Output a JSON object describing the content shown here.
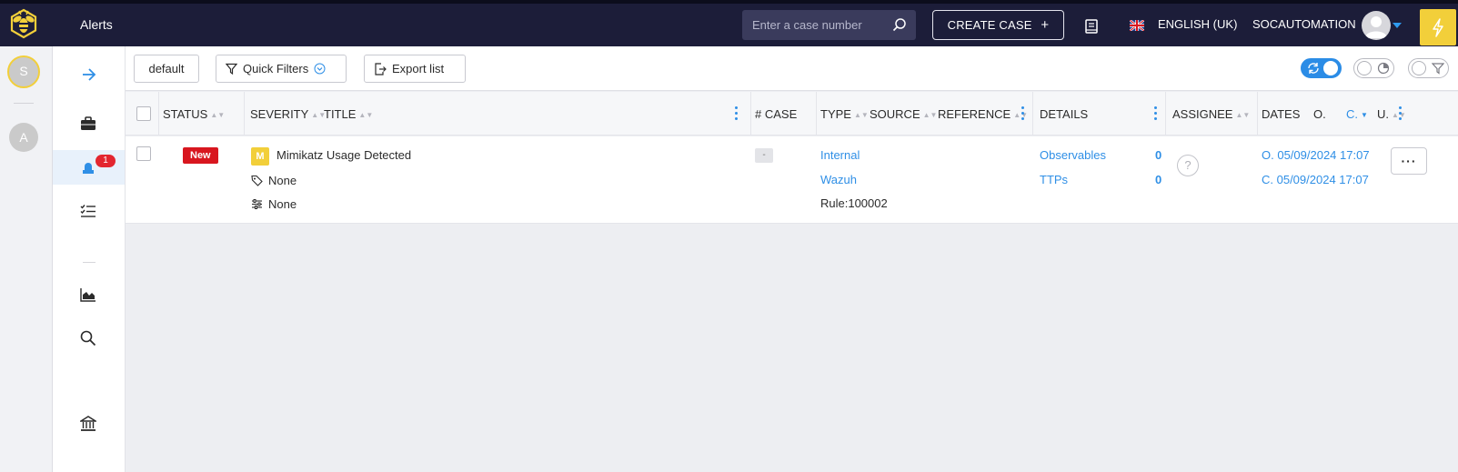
{
  "topbar": {
    "page_title": "Alerts",
    "search_placeholder": "Enter a case number",
    "create_case_label": "CREATE CASE",
    "language": "ENGLISH (UK)",
    "org": "SOCAUTOMATION"
  },
  "rail": {
    "org_initial": "S",
    "user_initial": "A"
  },
  "sidenav": {
    "alerts_badge": "1"
  },
  "toolbar": {
    "filter_default": "default",
    "quick_filters": "Quick Filters",
    "export_list": "Export list"
  },
  "table": {
    "headers": {
      "status": "STATUS",
      "severity": "SEVERITY",
      "title": "TITLE",
      "case": "# CASE",
      "type": "TYPE",
      "source": "SOURCE",
      "reference": "REFERENCE",
      "details": "DETAILS",
      "assignee": "ASSIGNEE",
      "dates": "DATES",
      "dates_o": "O.",
      "dates_c": "C.",
      "dates_u": "U."
    },
    "row": {
      "status": "New",
      "severity": "M",
      "title": "Mimikatz Usage Detected",
      "tags": "None",
      "custom_fields": "None",
      "case": "-",
      "type": "Internal",
      "source": "Wazuh",
      "reference": "Rule:100002",
      "observables_label": "Observables",
      "observables_count": "0",
      "ttps_label": "TTPs",
      "ttps_count": "0",
      "date_occurred": "O. 05/09/2024 17:07",
      "date_created": "C. 05/09/2024 17:07",
      "more": "···"
    }
  },
  "colors": {
    "accent": "#2f8fe6",
    "brand_yellow": "#f2cf3a",
    "topbar": "#1c1d39",
    "status_new": "#d8161f"
  }
}
